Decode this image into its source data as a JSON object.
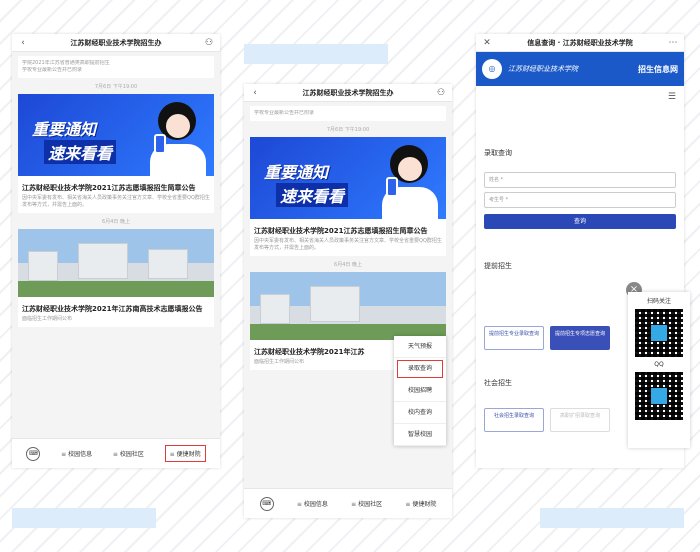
{
  "phone1": {
    "title": "江苏财经职业技术学院招生办",
    "top_snippet": [
      "学院2021年江苏省普通类高职提前招生",
      "学校专业最新公告并已附录"
    ],
    "date1": "7月6日 下午19:00",
    "banner_line1": "重要通知",
    "banner_line2": "速来看看",
    "article1_title": "江苏财经职业技术学院2021江苏志愿填报招生简章公告",
    "article1_desc": "因中央军委有发布、相关省海关人员政策事务关注官方文章、学校全省重要QQ群招生发布等方式，并需告上面的。",
    "date2": "6月4日 晚上",
    "article2_title": "江苏财经职业技术学院2021年江苏南高技术志愿填报公告",
    "article2_desc": "面临招生工作期间公布",
    "tabs": [
      "校园信息",
      "校园社区",
      "便捷财院"
    ],
    "keyboard_icon": "keyboard-icon"
  },
  "phone2": {
    "title": "江苏财经职业技术学院招生办",
    "top_snippet": [
      "学校专业最新公告并已附录"
    ],
    "date1": "7月6日 下午19:00",
    "banner_line1": "重要通知",
    "banner_line2": "速来看看",
    "article1_title": "江苏财经职业技术学院2021江苏志愿填报招生简章公告",
    "article1_desc": "因中央军委有发布、相关省海关人员政策事务关注官方文章、学校全省重要QQ群招生发布等方式，并需告上面的。",
    "date2": "6月4日 晚上",
    "article2_title": "江苏财经职业技术学院2021年江苏",
    "article2_desc": "面临招生工作期间公布",
    "menu": [
      "天气预报",
      "录取查询",
      "校园招聘",
      "校内查询",
      "智慧校园"
    ],
    "tabs": [
      "校园信息",
      "校园社区",
      "便捷财院"
    ]
  },
  "phone3": {
    "title": "信息查询 · 江苏财经职业技术学院",
    "brand_name": "江苏财经职业技术学院",
    "brand_tag": "招生信息网",
    "section1": "录取查询",
    "name_placeholder": "姓名 *",
    "id_placeholder": "考生号 *",
    "query_button": "查询",
    "section2": "提前招生",
    "btn_a": "提前招生专业录取查询",
    "btn_b": "提前招生专项志愿查询",
    "section3": "社会招生",
    "btn_c": "社会招生录取查询",
    "btn_d": "高职扩招录取查询",
    "qr_title": "扫码关注",
    "qr_label": "QQ"
  },
  "colors": {
    "accent": "#2b48b7",
    "highlight": "#e23b3b",
    "brand": "#1a59c7"
  }
}
